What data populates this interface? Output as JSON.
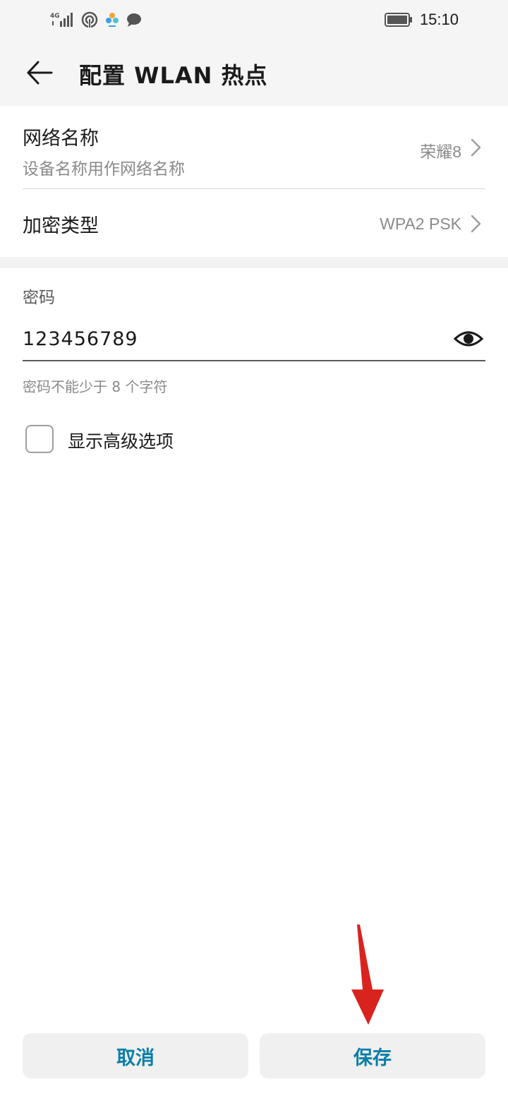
{
  "status_bar": {
    "network_type": "4G",
    "time": "15:10",
    "icons": [
      "signal-icon",
      "hotspot-icon",
      "app-icon",
      "chat-icon",
      "battery-icon"
    ]
  },
  "header": {
    "title": "配置 WLAN 热点",
    "back_icon": "arrow-left-icon"
  },
  "network_name": {
    "title": "网络名称",
    "subtitle": "设备名称用作网络名称",
    "value": "荣耀8"
  },
  "encryption": {
    "title": "加密类型",
    "value": "WPA2 PSK"
  },
  "password": {
    "label": "密码",
    "value": "123456789",
    "hint": "密码不能少于 8 个字符"
  },
  "advanced": {
    "label": "显示高级选项",
    "checked": false
  },
  "buttons": {
    "cancel": "取消",
    "save": "保存"
  },
  "colors": {
    "accent": "#0a7ea8",
    "annotation": "#d9231f",
    "background": "#f5f5f5"
  }
}
